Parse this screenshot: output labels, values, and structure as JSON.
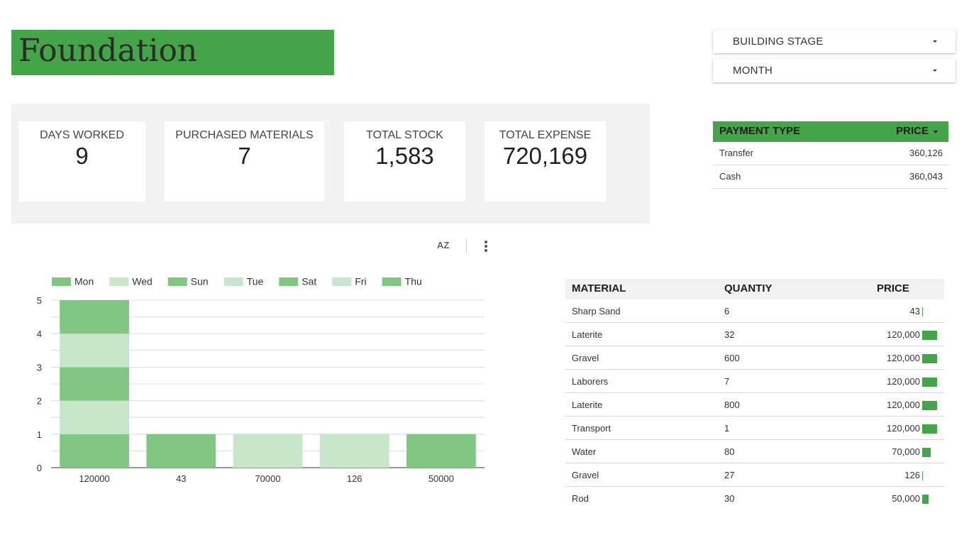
{
  "header": {
    "title": "Foundation"
  },
  "filters": {
    "stage_label": "BUILDING STAGE",
    "month_label": "MONTH"
  },
  "kpis": [
    {
      "label": "DAYS WORKED",
      "value": "9"
    },
    {
      "label": "PURCHASED MATERIALS",
      "value": "7"
    },
    {
      "label": "TOTAL STOCK",
      "value": "1,583"
    },
    {
      "label": "TOTAL EXPENSE",
      "value": "720,169"
    }
  ],
  "payment_table": {
    "headers": [
      "PAYMENT TYPE",
      "PRICE"
    ],
    "rows": [
      {
        "type": "Transfer",
        "price": "360,126"
      },
      {
        "type": "Cash",
        "price": "360,043"
      }
    ]
  },
  "chart_tools": {
    "sort_icon": "AZ"
  },
  "materials_table": {
    "headers": [
      "MATERIAL",
      "QUANTIY",
      "PRICE"
    ],
    "rows": [
      {
        "material": "Sharp Sand",
        "quantity": "6",
        "price": "43",
        "price_value": 43
      },
      {
        "material": "Laterite",
        "quantity": "32",
        "price": "120,000",
        "price_value": 120000
      },
      {
        "material": "Gravel",
        "quantity": "600",
        "price": "120,000",
        "price_value": 120000
      },
      {
        "material": "Laborers",
        "quantity": "7",
        "price": "120,000",
        "price_value": 120000
      },
      {
        "material": "Laterite",
        "quantity": "800",
        "price": "120,000",
        "price_value": 120000
      },
      {
        "material": "Transport",
        "quantity": "1",
        "price": "120,000",
        "price_value": 120000
      },
      {
        "material": "Water",
        "quantity": "80",
        "price": "70,000",
        "price_value": 70000
      },
      {
        "material": "Gravel",
        "quantity": "27",
        "price": "126",
        "price_value": 126
      },
      {
        "material": "Rod",
        "quantity": "30",
        "price": "50,000",
        "price_value": 50000
      }
    ]
  },
  "colors": {
    "accent": "#43a547",
    "day_dark": "#81c784",
    "day_light": "#c8e6c9",
    "panel_bg": "#f2f2f2"
  },
  "chart_data": {
    "type": "bar",
    "stacked": true,
    "categories": [
      "120000",
      "43",
      "70000",
      "126",
      "50000"
    ],
    "series": [
      {
        "name": "Mon",
        "color": "#81c784",
        "values": [
          1,
          1,
          0,
          0,
          0
        ]
      },
      {
        "name": "Wed",
        "color": "#c8e6c9",
        "values": [
          1,
          0,
          1,
          0,
          0
        ]
      },
      {
        "name": "Sun",
        "color": "#81c784",
        "values": [
          1,
          0,
          0,
          0,
          1
        ]
      },
      {
        "name": "Tue",
        "color": "#c8e6c9",
        "values": [
          1,
          0,
          0,
          0,
          0
        ]
      },
      {
        "name": "Sat",
        "color": "#81c784",
        "values": [
          1,
          0,
          0,
          0,
          0
        ]
      },
      {
        "name": "Fri",
        "color": "#c8e6c9",
        "values": [
          0,
          0,
          0,
          1,
          0
        ]
      },
      {
        "name": "Thu",
        "color": "#81c784",
        "values": [
          0,
          0,
          0,
          0,
          0
        ]
      }
    ],
    "ylim": [
      0,
      5
    ],
    "yticks": [
      0,
      1,
      2,
      3,
      4,
      5
    ],
    "grid": true,
    "legend": "top-left",
    "title": "",
    "xlabel": "",
    "ylabel": ""
  }
}
